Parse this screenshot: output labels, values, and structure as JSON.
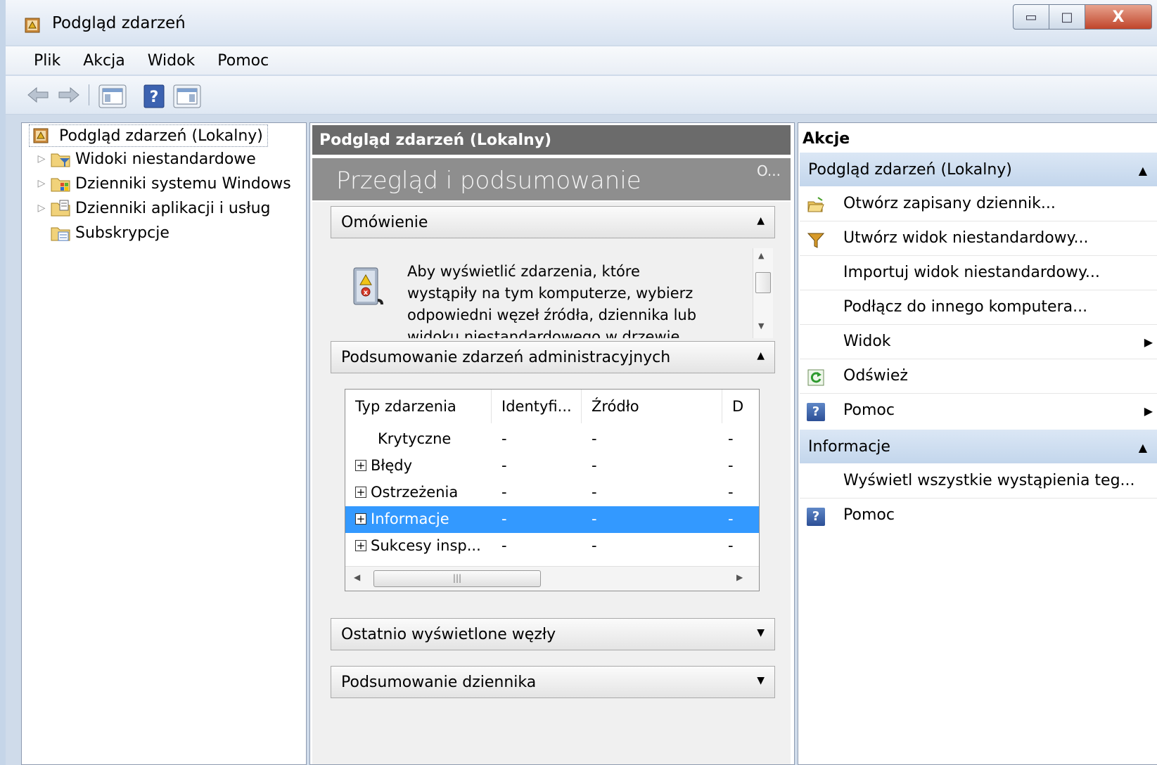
{
  "window": {
    "title": "Podgląd zdarzeń",
    "min_glyph": "▭",
    "max_glyph": "□",
    "close_glyph": "X"
  },
  "menu": [
    "Plik",
    "Akcja",
    "Widok",
    "Pomoc"
  ],
  "tree": {
    "root": "Podgląd zdarzeń (Lokalny)",
    "items": [
      "Widoki niestandardowe",
      "Dzienniki systemu Windows",
      "Dzienniki aplikacji i usług",
      "Subskrypcje"
    ]
  },
  "middle": {
    "header": "Podgląd zdarzeń (Lokalny)",
    "banner_title": "Przegląd i podsumowanie",
    "banner_more": "O...",
    "sections": {
      "overview": "Omówienie",
      "admin_summary": "Podsumowanie zdarzeń administracyjnych",
      "recent_nodes": "Ostatnio wyświetlone węzły",
      "log_summary": "Podsumowanie dziennika"
    },
    "overview_text": "Aby wyświetlić zdarzenia, które wystąpiły na tym komputerze, wybierz odpowiedni węzeł źródła, dziennika lub widoku niestandardowego w drzewie konsoli",
    "table": {
      "columns": [
        "Typ zdarzenia",
        "Identyfi...",
        "Źródło",
        "D"
      ],
      "rows": [
        {
          "type": "Krytyczne",
          "id": "-",
          "source": "-",
          "d": "-",
          "expandable": false,
          "selected": false
        },
        {
          "type": "Błędy",
          "id": "-",
          "source": "-",
          "d": "-",
          "expandable": true,
          "selected": false
        },
        {
          "type": "Ostrzeżenia",
          "id": "-",
          "source": "-",
          "d": "-",
          "expandable": true,
          "selected": false
        },
        {
          "type": "Informacje",
          "id": "-",
          "source": "-",
          "d": "-",
          "expandable": true,
          "selected": true
        },
        {
          "type": "Sukcesy insp...",
          "id": "-",
          "source": "-",
          "d": "-",
          "expandable": true,
          "selected": false
        }
      ]
    }
  },
  "actions": {
    "heading": "Akcje",
    "group1": {
      "title": "Podgląd zdarzeń (Lokalny)",
      "items": [
        {
          "label": "Otwórz zapisany dziennik...",
          "icon": "open-folder-icon"
        },
        {
          "label": "Utwórz widok niestandardowy...",
          "icon": "filter-icon"
        },
        {
          "label": "Importuj widok niestandardowy...",
          "icon": ""
        },
        {
          "label": "Podłącz do innego komputera...",
          "icon": ""
        },
        {
          "label": "Widok",
          "icon": "",
          "submenu": true
        },
        {
          "label": "Odśwież",
          "icon": "refresh-icon"
        },
        {
          "label": "Pomoc",
          "icon": "help-icon",
          "submenu": true
        }
      ]
    },
    "group2": {
      "title": "Informacje",
      "items": [
        {
          "label": "Wyświetl wszystkie wystąpienia teg...",
          "icon": ""
        },
        {
          "label": "Pomoc",
          "icon": "help-icon"
        }
      ]
    }
  },
  "colors": {
    "selection": "#3399ff",
    "header_dark": "#6b6b6b",
    "banner": "#8e8e8e",
    "action_group": "#c3d6ec"
  }
}
